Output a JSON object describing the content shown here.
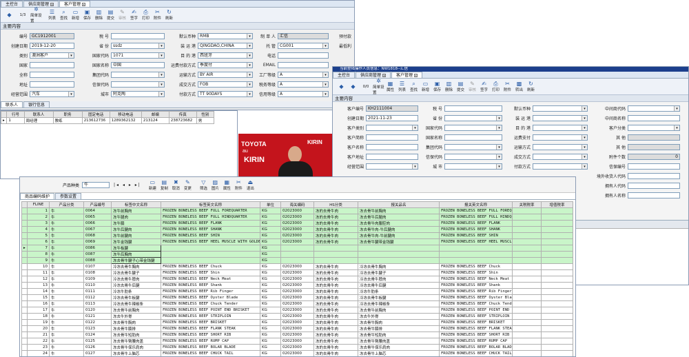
{
  "w1": {
    "tabs": [
      "主控台",
      "供应商管理",
      "客户管理"
    ],
    "pager": "1/3",
    "toolbar": [
      "简单设置",
      "列表",
      "查找",
      "新增",
      "保存",
      "删除",
      "提交",
      "审核",
      "签字",
      "打印",
      "附件",
      "刷新"
    ],
    "section": "主要内容",
    "fields": {
      "code_l": "编号",
      "code": "GC1912001",
      "date_l": "创建日期",
      "date": "2019-12-20",
      "cat_l": "类别",
      "cat": "澳洲客户",
      "country_l": "国家",
      "country": "",
      "full_l": "全称",
      "full": "",
      "addr_l": "地址",
      "addr": "",
      "scope_l": "经营范围",
      "scope": "汽车",
      "tax_l": "税  号",
      "tax": "",
      "prov_l": "省  份",
      "prov": "ssdz",
      "ccode_l": "国家代码",
      "ccode": "1071",
      "cname_l": "国家名称",
      "cname": "中国",
      "grp_l": "集团代码",
      "grp": "",
      "credit_l": "信保代码",
      "credit": "",
      "city_l": "城市",
      "city": "阿克陶",
      "cur_l": "默认币种",
      "cur": "RMB",
      "port_l": "装 运 港",
      "port": "QINGDAO,CHINA",
      "dest_l": "目 的 港",
      "dest": "西班牙",
      "pay_l": "运费付款方式",
      "pay": "季度付",
      "trans_l": "运输方式",
      "trans": "BY AIR",
      "deal_l": "成交方式",
      "deal": "FOB",
      "pterm_l": "付款方式",
      "pterm": "TT 90DAYS",
      "maker_l": "制 单 人",
      "maker": "汇信",
      "trust_l": "托  管",
      "trust": "CG001",
      "tel_l": "电话",
      "tel": "",
      "email_l": "EMAIL",
      "email": "",
      "fac_l": "工厂等级",
      "fac": "A",
      "taxg_l": "税务等级",
      "taxg": "A",
      "crg_l": "信用等级",
      "crg": "A",
      "pre_l": "预付款",
      "rec_l": "最低利"
    },
    "subtabs": [
      "联系人",
      "银行信息"
    ],
    "contact_headers": [
      "行号",
      "联系人",
      "职务",
      "固定电话",
      "移动电话",
      "邮编",
      "传真",
      "性别"
    ],
    "contact_row": [
      "1",
      "周经理",
      "教练",
      "213612736",
      "1289362132",
      "213124",
      "238723682",
      "男"
    ]
  },
  "w2": {
    "title": "当前登陆操作人员信息：NW1818--汇信",
    "tabs": [
      "主控台",
      "供应商管理",
      "客户管理"
    ],
    "pager": "0/0",
    "toolbar": [
      "简单设置",
      "属性",
      "列表",
      "查找",
      "新增",
      "保存",
      "删除",
      "提交",
      "审核",
      "签字",
      "打印",
      "附件",
      "转出",
      "刷新"
    ],
    "section": "主要内容",
    "fields": {
      "code_l": "客户编号",
      "code": "KH2111004",
      "date_l": "创建日期",
      "date": "2021-11-23",
      "cat_l": "客户类别",
      "short_l": "客户简称",
      "name_l": "客户名称",
      "addr_l": "客户地址",
      "scope_l": "经营范围",
      "tax_l": "税  号",
      "prov_l": "省  份",
      "ccode_l": "国家代码",
      "cname_l": "国家名称",
      "grp_l": "集团代码",
      "credit_l": "信保代码",
      "city_l": "城  市",
      "cur_l": "默认币种",
      "port_l": "装 运 港",
      "dest_l": "目 的 港",
      "pay_l": "运费支付",
      "trans_l": "运输方式",
      "deal_l": "成交方式",
      "pterm_l": "付款方式",
      "agent_l": "中间商代码",
      "agentn_l": "中间商名称",
      "ccat_l": "客户分类",
      "other1_l": "其  他",
      "other2_l": "其  他",
      "att_l": "附件个数",
      "att": "0",
      "crno_l": "信保编号",
      "oversea_l": "境外收货人代码",
      "owner_l": "拥有人代码",
      "ownern_l": "拥有人名称"
    }
  },
  "w3": {
    "filter_label": "产品种类",
    "filter_value": "牛",
    "toolbar": [
      "新建",
      "复制",
      "取消",
      "变更",
      "筛选",
      "图片",
      "属性",
      "附件",
      "退出"
    ],
    "tabs": [
      "商品编码维护",
      "参数设置"
    ],
    "headers": [
      "FLINE",
      "产品分类",
      "产品编号",
      "标签中文名称",
      "标签英文名称",
      "单位",
      "海关编码",
      "HS分类",
      "报关品名",
      "报关英文名称",
      "关税税率",
      "增值税率"
    ],
    "rows": [
      [
        "1",
        "牛",
        "0064",
        "冻牛前胸肉",
        "FROZEN BONELESS BEEF FULL FOREQUARTER",
        "KG",
        "02023000",
        "冻的去骨牛肉",
        "冻去骨牛前胸肉",
        "FROZEN BONELESS BEEF FULL FOREQUARTER",
        "",
        ""
      ],
      [
        "2",
        "牛",
        "0065",
        "冻牛腿肉",
        "FROZEN BONELESS BEEF FULL HINDQUARTER",
        "KG",
        "02023000",
        "冻的去骨牛肉",
        "冻去骨牛后腿肉",
        "FROZEN BONELESS BEEF FULL HINDQUARTER",
        "",
        ""
      ],
      [
        "3",
        "牛",
        "0066",
        "冻牛腩",
        "FROZEN BONELESS BEEF FLANK",
        "KG",
        "02023000",
        "冻的去骨牛肉",
        "冻去骨牛肉腹腔肉",
        "FROZEN BONELESS BEEF FLANK",
        "",
        ""
      ],
      [
        "4",
        "牛",
        "0067",
        "冻牛后腱肉",
        "FROZEN BONELESS BEEF SHANK",
        "KG",
        "02023000",
        "冻的去骨牛肉",
        "冻去骨牛肉-牛后腱肉",
        "FROZEN BONELESS BEEF SHANK",
        "",
        ""
      ],
      [
        "5",
        "牛",
        "0068",
        "冻牛前腱肉",
        "FROZEN BONELESS BEEF SHIN",
        "KG",
        "02023000",
        "冻的去骨牛肉",
        "冻去骨牛肉-牛前腱肉",
        "FROZEN BONELESS BEEF SHIN",
        "",
        ""
      ],
      [
        "6",
        "牛",
        "0069",
        "冻牛金钱腱",
        "FROZEN BONELESS BEEF HEEL MUSCLE WITH GOLDEN COIN",
        "KG",
        "02023000",
        "冻的去骨牛肉",
        "冻去骨牛腱带金钱腱",
        "FROZEN BONELESS BEEF HEEL MUSCLE WITH",
        "",
        ""
      ],
      [
        "7",
        "牛",
        "0086",
        "冻牛板腱",
        "",
        "KG",
        "",
        "",
        "",
        "",
        "",
        ""
      ],
      [
        "8",
        "牛",
        "0087",
        "冻牛后胸肉",
        "",
        "KG",
        "",
        "",
        "",
        "",
        "",
        ""
      ],
      [
        "9",
        "牛",
        "0088",
        "冻去骨牛腱子心带金钱腱",
        "",
        "KG",
        "",
        "",
        "",
        "",
        "",
        ""
      ],
      [
        "10",
        "牛",
        "0107",
        "冷冻去骨牛胸肉",
        "FROZEN BONELESS BEEF Chuck",
        "KG",
        "02023000",
        "冻的去骨牛肉",
        "冷冻去骨牛胸肉",
        "FROZEN BONELESS BEEF Chuck",
        "",
        ""
      ],
      [
        "11",
        "牛",
        "0108",
        "冷冻去骨牛腱子",
        "FROZEN BONELESS BEEF Shin",
        "KG",
        "02023000",
        "冻的去骨牛肉",
        "冷冻去骨牛腱子",
        "FROZEN BONELESS BEEF Shin",
        "",
        ""
      ],
      [
        "12",
        "牛",
        "0109",
        "冷冻去骨牛脖肉",
        "FROZEN BONELESS BEEF Neck Meat",
        "KG",
        "02023000",
        "冻的去骨牛肉",
        "冷冻去骨牛脖肉",
        "FROZEN BONELESS BEEF Neck Meat",
        "",
        ""
      ],
      [
        "13",
        "牛",
        "0110",
        "冷冻去骨牛后腱",
        "FROZEN BONELESS BEEF Shank",
        "KG",
        "02023000",
        "冻的去骨牛肉",
        "冷冻去骨牛后腱",
        "FROZEN BONELESS BEEF Shank",
        "",
        ""
      ],
      [
        "14",
        "牛",
        "0111",
        "冷冻牛肋条",
        "FROZEN BONELESS BEEF Rib Finger",
        "KG",
        "02023000",
        "冻的去骨牛肉",
        "冷冻牛肋条",
        "FROZEN BONELESS BEEF Rib Finger",
        "",
        ""
      ],
      [
        "15",
        "牛",
        "0112",
        "冷冻去骨牛板腱",
        "FROZEN BONELESS BEEF  Oyster Blade",
        "KG",
        "02023000",
        "冻的去骨牛肉",
        "冷冻去骨牛板腱",
        "FROZEN BONELESS BEEF  Oyster Blade",
        "",
        ""
      ],
      [
        "16",
        "牛",
        "0113",
        "冷冻去骨牛辣椒条",
        "FROZEN BONELESS BEEF  Chuck Tender",
        "KG",
        "02023000",
        "冻的去骨牛肉",
        "冷冻去骨牛辣椒条",
        "FROZEN BONELESS BEEF  Chuck Tender",
        "",
        ""
      ],
      [
        "17",
        "牛",
        "0120",
        "冻去骨牛前胸肉",
        "FROZEN BONELESS BEEF POINT END BRISKET",
        "KG",
        "02023000",
        "冻的去骨牛肉",
        "冻去骨牛前胸肉",
        "FROZEN BONELESS BEEF POINT END BRISKET",
        "",
        ""
      ],
      [
        "18",
        "牛",
        "0121",
        "冻去牛外脊",
        "FROZEN BONELESS BEEF STRIPLOIN",
        "KG",
        "02023000",
        "冻的去骨牛肉",
        "冻去牛外脊",
        "FROZEN BONELESS BEEF STRIPLOIN",
        "",
        ""
      ],
      [
        "19",
        "牛",
        "0122",
        "冻去骨牛胸肉",
        "FROZEN BONELESS BEEF BRISKET",
        "KG",
        "02023000",
        "冻的去骨牛肉",
        "冻去骨牛胸肉",
        "FROZEN BONELESS BEEF BRISKET",
        "",
        ""
      ],
      [
        "20",
        "牛",
        "0123",
        "冻去骨牛腩排",
        "FROZEN BONELESS BEEF FLANK STEAK",
        "KG",
        "02023000",
        "冻的去骨牛肉",
        "冻去骨牛腩排",
        "FROZEN BONELESS BEEF FLANK STEAK",
        "",
        ""
      ],
      [
        "21",
        "牛",
        "0124",
        "冻去骨牛短肋肉",
        "FROZEN BONELESS BEEF SHORT RIB",
        "KG",
        "02023000",
        "冻的去骨牛肉",
        "冻去骨牛短肋肉",
        "FROZEN BONELESS BEEF SHORT RIB",
        "",
        ""
      ],
      [
        "22",
        "牛",
        "0125",
        "冻去骨牛臀腰肉盖",
        "FROZEN BONELESS BEEF RUMP CAP",
        "KG",
        "02023000",
        "冻的去骨牛肉",
        "冻去骨牛臀腰肉盖",
        "FROZEN BONELESS BEEF RUMP CAP",
        "",
        ""
      ],
      [
        "23",
        "牛",
        "0126",
        "冻去骨牛保乐肩肉",
        "FROZEN BONELESS BEEF BOLAR BLADE",
        "KG",
        "02023000",
        "冻的去骨牛肉",
        "冻去骨牛保乐肩肉",
        "FROZEN BONELESS BEEF BOLAR BLADE",
        "",
        ""
      ],
      [
        "24",
        "牛",
        "0127",
        "冻去骨牛上脑芯",
        "FROZEN BONELESS BEEF CHUCK TAIL",
        "KG",
        "02023000",
        "冻的去骨牛肉",
        "冻去骨牛上脑芯",
        "FROZEN BONELESS BEEF CHUCK TAIL",
        "",
        ""
      ],
      [
        "25",
        "牛",
        "0128",
        "冻去骨牛腱子肉",
        "FROZEN BONELESS BEEF SHIN/SHANK",
        "KG",
        "02023000",
        "冻的去骨牛肉",
        "冻去骨牛腱子肉",
        "FROZEN BONELESS BEEF SHIN/SHANK",
        "",
        ""
      ]
    ]
  },
  "photo": {
    "sponsors": [
      "TOYOTA",
      "KIRIN",
      "au",
      "KIRIN"
    ]
  }
}
